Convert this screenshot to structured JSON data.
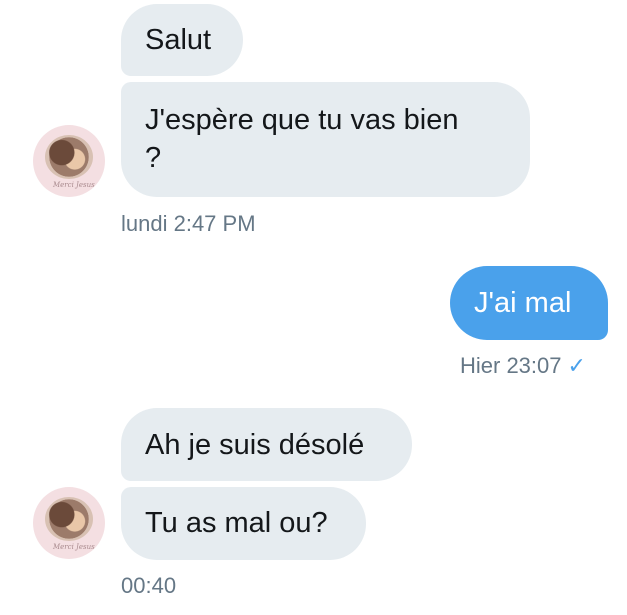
{
  "conversation": {
    "group1": {
      "messages": [
        {
          "text": "Salut"
        },
        {
          "text_line1": "J'espère que tu vas bien",
          "text_line2": "?"
        }
      ],
      "avatar_signature": "Merci Jesus",
      "timestamp": "lundi 2:47 PM"
    },
    "group2": {
      "message": "J'ai mal",
      "timestamp": "Hier 23:07",
      "read_icon": "check-icon"
    },
    "group3": {
      "messages": [
        {
          "text": "Ah je suis désolé"
        },
        {
          "text": "Tu as mal ou?"
        }
      ],
      "avatar_signature": "Merci Jesus",
      "timestamp": "00:40"
    }
  },
  "colors": {
    "incoming_bubble": "#e6ecf0",
    "outgoing_bubble": "#4aa1eb",
    "timestamp_text": "#657786",
    "message_text": "#14171a"
  }
}
